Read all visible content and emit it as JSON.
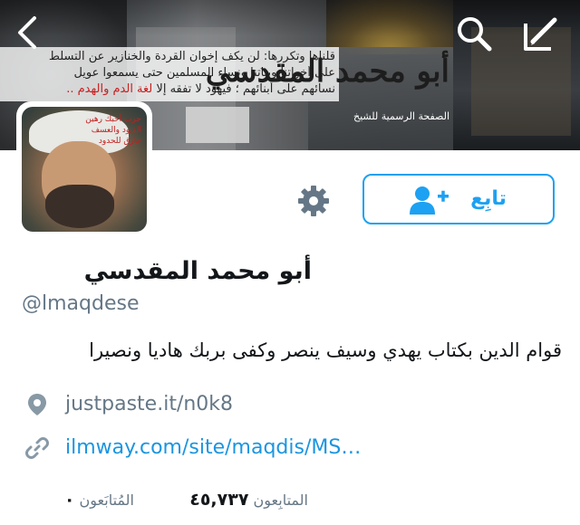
{
  "banner": {
    "quote_lines": [
      "قلناها وتكررها: لن يكف إخوان القردة والخنازير عن التسلط",
      "على أخواتنا وبناتنا ونساء المسلمين حتى يسمعوا عويل",
      "نسائهم على أبنائهم ؛ فيهود لا تفقه إلا"
    ],
    "quote_highlight": "لغة الدم والهدم ..",
    "logo_title": "أبو محمد المقدسي",
    "logo_subtitle": "الصفحة الرسمية للشيخ"
  },
  "avatar_caption": "حرب أحبك رهين القيود والعسف حارق للحدود",
  "follow_button": {
    "label": "تابِع"
  },
  "profile": {
    "display_name": "أبو محمد المقدسي",
    "handle": "@lmaqdese",
    "bio": "قوام الدين بكتاب يهدي وسيف ينصر وكفى بربك هاديا ونصيرا",
    "location": "justpaste.it/n0k8",
    "website": "ilmway.com/site/maqdis/MS…"
  },
  "stats": {
    "followers_count": "٤٥,٧٣٧",
    "followers_label": "المتابِعون",
    "following_count": "٠",
    "following_label": "المُتابَعون"
  },
  "colors": {
    "accent": "#1da1f2",
    "link": "#1b95e0",
    "muted": "#657786",
    "text": "#14171a"
  },
  "icons": [
    "back-icon",
    "search-icon",
    "compose-icon",
    "gear-icon",
    "add-user-icon",
    "location-pin-icon",
    "link-icon"
  ]
}
